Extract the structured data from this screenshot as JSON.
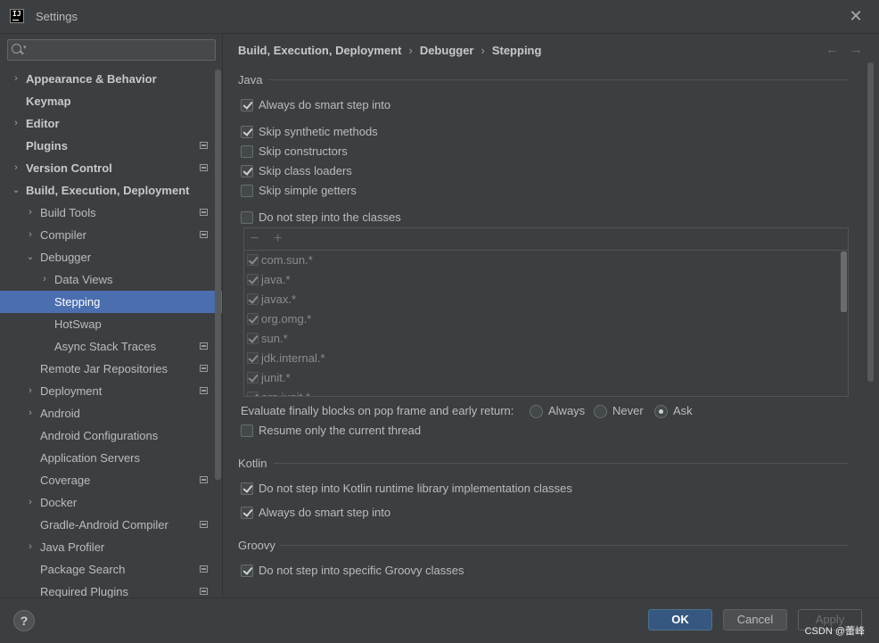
{
  "window": {
    "title": "Settings",
    "app_icon": "intellij-icon"
  },
  "sidebar": {
    "search": {
      "placeholder": ""
    },
    "items": [
      {
        "label": "Appearance & Behavior",
        "level": 0,
        "chevron": "›",
        "bold": true
      },
      {
        "label": "Keymap",
        "level": 0,
        "chevron": "",
        "bold": true
      },
      {
        "label": "Editor",
        "level": 0,
        "chevron": "›",
        "bold": true
      },
      {
        "label": "Plugins",
        "level": 0,
        "chevron": "",
        "bold": true,
        "project_icon": true
      },
      {
        "label": "Version Control",
        "level": 0,
        "chevron": "›",
        "bold": true,
        "project_icon": true
      },
      {
        "label": "Build, Execution, Deployment",
        "level": 0,
        "chevron": "⌄",
        "bold": true
      },
      {
        "label": "Build Tools",
        "level": 1,
        "chevron": "›",
        "project_icon": true
      },
      {
        "label": "Compiler",
        "level": 1,
        "chevron": "›",
        "project_icon": true
      },
      {
        "label": "Debugger",
        "level": 1,
        "chevron": "⌄"
      },
      {
        "label": "Data Views",
        "level": 2,
        "chevron": "›"
      },
      {
        "label": "Stepping",
        "level": 2,
        "chevron": "",
        "selected": true
      },
      {
        "label": "HotSwap",
        "level": 2,
        "chevron": ""
      },
      {
        "label": "Async Stack Traces",
        "level": 2,
        "chevron": "",
        "project_icon": true
      },
      {
        "label": "Remote Jar Repositories",
        "level": 1,
        "chevron": "",
        "project_icon": true
      },
      {
        "label": "Deployment",
        "level": 1,
        "chevron": "›",
        "project_icon": true
      },
      {
        "label": "Android",
        "level": 1,
        "chevron": "›"
      },
      {
        "label": "Android Configurations",
        "level": 1,
        "chevron": ""
      },
      {
        "label": "Application Servers",
        "level": 1,
        "chevron": ""
      },
      {
        "label": "Coverage",
        "level": 1,
        "chevron": "",
        "project_icon": true
      },
      {
        "label": "Docker",
        "level": 1,
        "chevron": "›"
      },
      {
        "label": "Gradle-Android Compiler",
        "level": 1,
        "chevron": "",
        "project_icon": true
      },
      {
        "label": "Java Profiler",
        "level": 1,
        "chevron": "›"
      },
      {
        "label": "Package Search",
        "level": 1,
        "chevron": "",
        "project_icon": true
      },
      {
        "label": "Required Plugins",
        "level": 1,
        "chevron": "",
        "project_icon": true
      }
    ]
  },
  "breadcrumb": [
    "Build, Execution, Deployment",
    "Debugger",
    "Stepping"
  ],
  "nav": {
    "back": "←",
    "forward": "→"
  },
  "java": {
    "title": "Java",
    "options": [
      {
        "label": "Always do smart step into",
        "checked": true
      },
      {
        "label": "Skip synthetic methods",
        "checked": true
      },
      {
        "label": "Skip constructors",
        "checked": false
      },
      {
        "label": "Skip class loaders",
        "checked": true
      },
      {
        "label": "Skip simple getters",
        "checked": false
      },
      {
        "label": "Do not step into the classes",
        "checked": false
      }
    ],
    "toolbar": {
      "remove": "−",
      "add": "+"
    },
    "classes": [
      {
        "label": "com.sun.*",
        "checked": true
      },
      {
        "label": "java.*",
        "checked": true
      },
      {
        "label": "javax.*",
        "checked": true
      },
      {
        "label": "org.omg.*",
        "checked": true
      },
      {
        "label": "sun.*",
        "checked": true
      },
      {
        "label": "jdk.internal.*",
        "checked": true
      },
      {
        "label": "junit.*",
        "checked": true
      },
      {
        "label": "org.junit.*",
        "checked": true
      }
    ],
    "evaluate": {
      "label": "Evaluate finally blocks on pop frame and early return:",
      "options": [
        "Always",
        "Never",
        "Ask"
      ],
      "selected": "Ask"
    },
    "resume": {
      "label": "Resume only the current thread",
      "checked": false
    }
  },
  "kotlin": {
    "title": "Kotlin",
    "options": [
      {
        "label": "Do not step into Kotlin runtime library implementation classes",
        "checked": true
      },
      {
        "label": "Always do smart step into",
        "checked": true
      }
    ]
  },
  "groovy": {
    "title": "Groovy",
    "options": [
      {
        "label": "Do not step into specific Groovy classes",
        "checked": true
      }
    ]
  },
  "footer": {
    "help": "?",
    "ok": "OK",
    "cancel": "Cancel",
    "apply": "Apply",
    "watermark": "CSDN @蕾峰"
  },
  "colors": {
    "selection": "#4b6eaf",
    "background": "#3c3f41",
    "ok_button": "#365880"
  }
}
